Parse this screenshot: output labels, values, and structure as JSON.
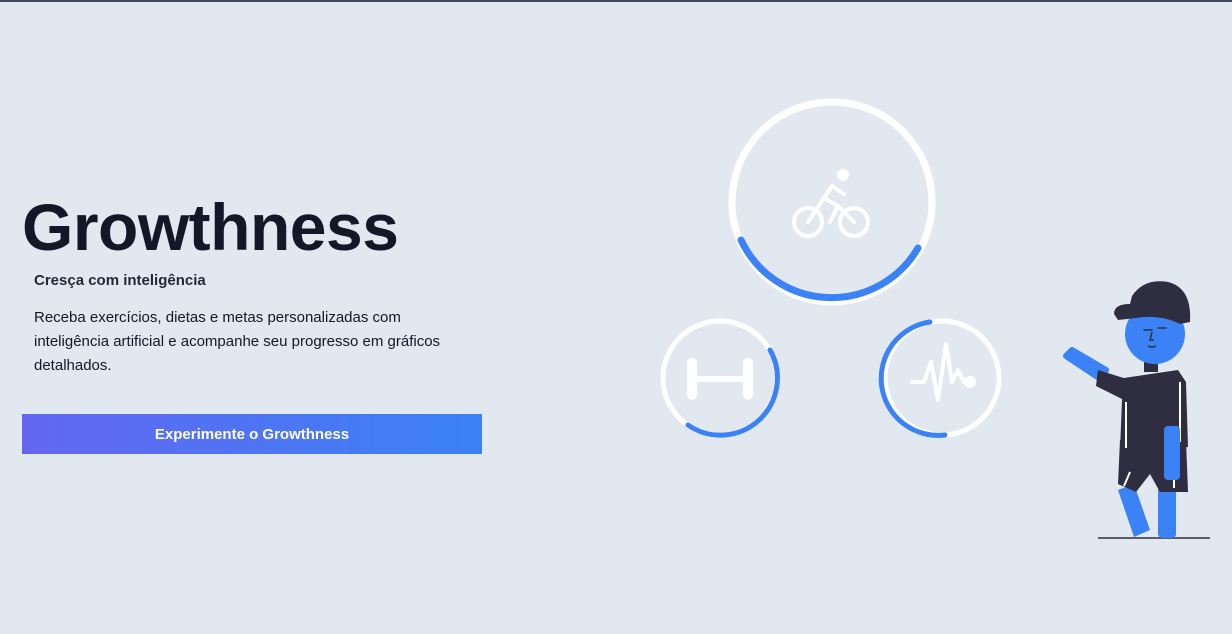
{
  "hero": {
    "title": "Growthness",
    "subtitle": "Cresça com inteligência",
    "description": "Receba exercícios, dietas e metas personalizadas com inteligência artificial e acompanhe seu progresso em gráficos detalhados.",
    "cta_label": "Experimente o Growthness"
  },
  "colors": {
    "background": "#e2e8f0",
    "accent_start": "#6366f1",
    "accent_end": "#3b82f6",
    "progress": "#3b82f6",
    "figure_dark": "#2f2e41",
    "heading": "#111827"
  },
  "illustration": {
    "icons": [
      "bike-icon",
      "dumbbell-icon",
      "heartbeat-icon"
    ]
  }
}
